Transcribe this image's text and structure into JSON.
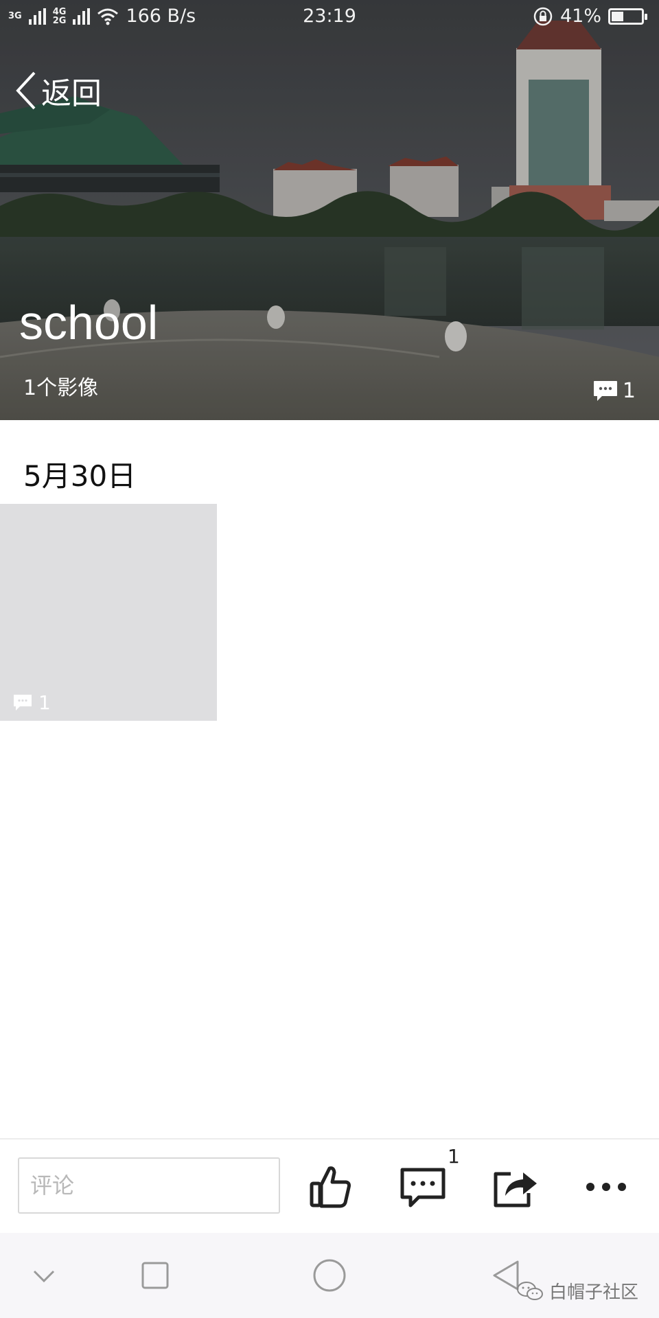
{
  "status_bar": {
    "network_top": "3G",
    "network_mid": "4G",
    "network_bottom": "2G",
    "speed": "166 B/s",
    "time": "23:19",
    "battery_text": "41%",
    "battery_level": 0.41
  },
  "header": {
    "back_label": "返回"
  },
  "album": {
    "title": "school",
    "count_text": "1个影像",
    "comment_count": "1"
  },
  "content": {
    "date_label": "5月30日",
    "items": [
      {
        "comment_count": "1"
      }
    ]
  },
  "action_bar": {
    "comment_placeholder": "评论",
    "comment_count": "1"
  },
  "watermark": {
    "text": "白帽子社区"
  },
  "colors": {
    "thumbnail_placeholder": "#dedee0",
    "navbar_bg": "#f7f6f9"
  }
}
